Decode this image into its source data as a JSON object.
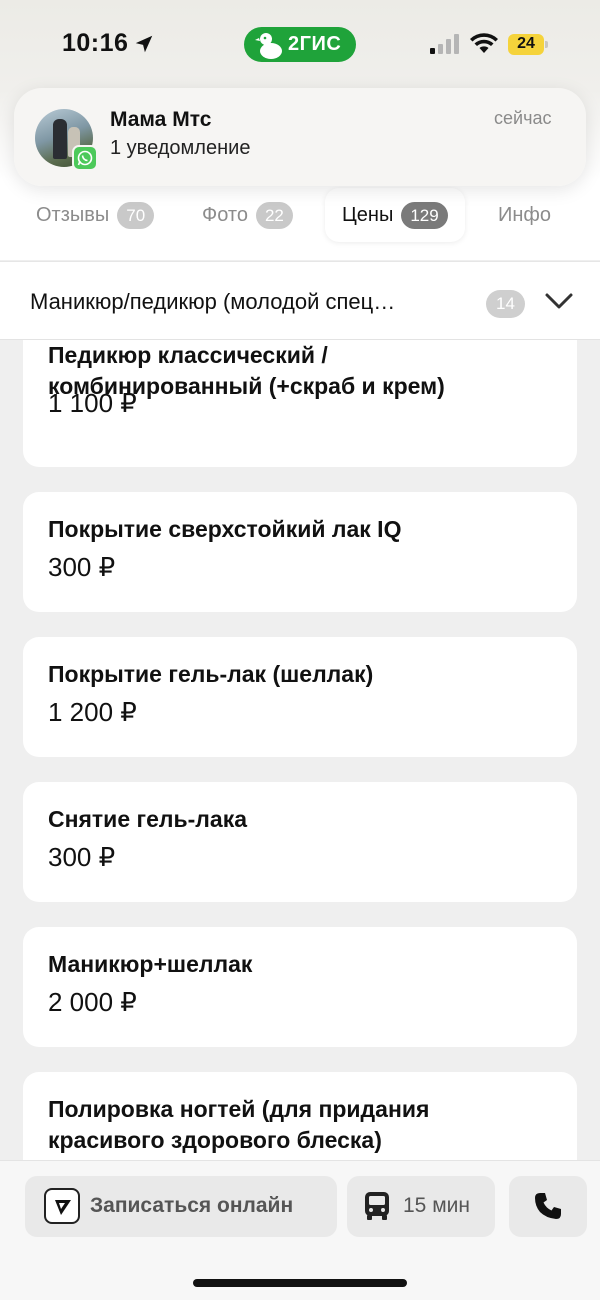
{
  "status_bar": {
    "time": "10:16",
    "app_badge": "2ГИС",
    "battery": "24"
  },
  "notification": {
    "title": "Мама Мтс",
    "subtitle": "1 уведомление",
    "time": "сейчас"
  },
  "tabs": [
    {
      "label": "Отзывы",
      "count": "70",
      "active": false
    },
    {
      "label": "Фото",
      "count": "22",
      "active": false
    },
    {
      "label": "Цены",
      "count": "129",
      "active": true
    },
    {
      "label": "Инфо",
      "count": "",
      "active": false
    }
  ],
  "category": {
    "label": "Маникюр/педикюр (молодой спец…",
    "count": "14"
  },
  "prices": [
    {
      "name": "Педикюр классический / комбинированный (+скраб и крем)",
      "price": "1 100 ₽"
    },
    {
      "name": "Покрытие сверхстойкий лак IQ",
      "price": "300 ₽"
    },
    {
      "name": "Покрытие гель-лак (шеллак)",
      "price": "1 200 ₽"
    },
    {
      "name": "Снятие гель-лака",
      "price": "300 ₽"
    },
    {
      "name": "Маникюр+шеллак",
      "price": "2 000 ₽"
    },
    {
      "name": "Полировка ногтей (для придания красивого здорового блеска)",
      "price": ""
    }
  ],
  "bottom_bar": {
    "book_label": "Записаться онлайн",
    "route_label": "15 мин"
  },
  "colors": {
    "brand_green": "#1fa33a",
    "battery_yellow": "#f5d33b",
    "whatsapp_green": "#4cc95a"
  }
}
